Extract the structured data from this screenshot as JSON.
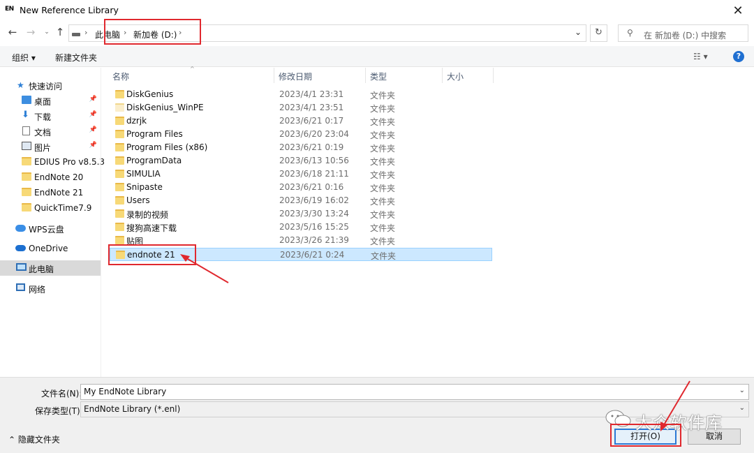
{
  "window": {
    "app_logo": "EN",
    "title": "New Reference Library",
    "close_icon": "close-icon"
  },
  "address_bar": {
    "crumbs": [
      "此电脑",
      "新加卷 (D:)"
    ],
    "search_placeholder": "在 新加卷 (D:) 中搜索"
  },
  "toolbar": {
    "organize_label": "组织 ▾",
    "new_folder_label": "新建文件夹"
  },
  "sidebar": {
    "quick_access_label": "快速访问",
    "items": [
      {
        "label": "桌面",
        "icon": "desktop-icon",
        "pinned": true
      },
      {
        "label": "下载",
        "icon": "download-icon",
        "pinned": true
      },
      {
        "label": "文档",
        "icon": "document-icon",
        "pinned": true
      },
      {
        "label": "图片",
        "icon": "picture-icon",
        "pinned": true
      },
      {
        "label": "EDIUS Pro v8.5.3",
        "icon": "folder-icon"
      },
      {
        "label": "EndNote 20",
        "icon": "folder-icon"
      },
      {
        "label": "EndNote 21",
        "icon": "folder-icon"
      },
      {
        "label": "QuickTime7.9",
        "icon": "folder-icon"
      }
    ],
    "wps_label": "WPS云盘",
    "onedrive_label": "OneDrive",
    "this_pc_label": "此电脑",
    "network_label": "网络"
  },
  "file_list": {
    "columns": [
      "名称",
      "修改日期",
      "类型",
      "大小"
    ],
    "rows": [
      {
        "name": "DiskGenius",
        "date": "2023/4/1 23:31",
        "type": "文件夹"
      },
      {
        "name": "DiskGenius_WinPE",
        "date": "2023/4/1 23:51",
        "type": "文件夹"
      },
      {
        "name": "dzrjk",
        "date": "2023/6/21 0:17",
        "type": "文件夹"
      },
      {
        "name": "Program Files",
        "date": "2023/6/20 23:04",
        "type": "文件夹"
      },
      {
        "name": "Program Files (x86)",
        "date": "2023/6/21 0:19",
        "type": "文件夹"
      },
      {
        "name": "ProgramData",
        "date": "2023/6/13 10:56",
        "type": "文件夹"
      },
      {
        "name": "SIMULIA",
        "date": "2023/6/18 21:11",
        "type": "文件夹"
      },
      {
        "name": "Snipaste",
        "date": "2023/6/21 0:16",
        "type": "文件夹"
      },
      {
        "name": "Users",
        "date": "2023/6/19 16:02",
        "type": "文件夹"
      },
      {
        "name": "录制的视频",
        "date": "2023/3/30 13:24",
        "type": "文件夹"
      },
      {
        "name": "搜狗高速下载",
        "date": "2023/5/16 15:25",
        "type": "文件夹"
      },
      {
        "name": "贴图",
        "date": "2023/3/26 21:39",
        "type": "文件夹"
      },
      {
        "name": "endnote 21",
        "date": "2023/6/21 0:24",
        "type": "文件夹"
      }
    ]
  },
  "bottom": {
    "filename_label": "文件名(N):",
    "filename_value": "My EndNote Library",
    "filetype_label": "保存类型(T):",
    "filetype_value": "EndNote Library (*.enl)",
    "hide_folders_label": "隐藏文件夹",
    "open_label": "打开(O)",
    "cancel_label": "取消",
    "watermark": "大众软件库"
  },
  "colors": {
    "accent": "#2b79d6",
    "selection": "#cce8ff",
    "annotation_red": "#e0282e"
  }
}
